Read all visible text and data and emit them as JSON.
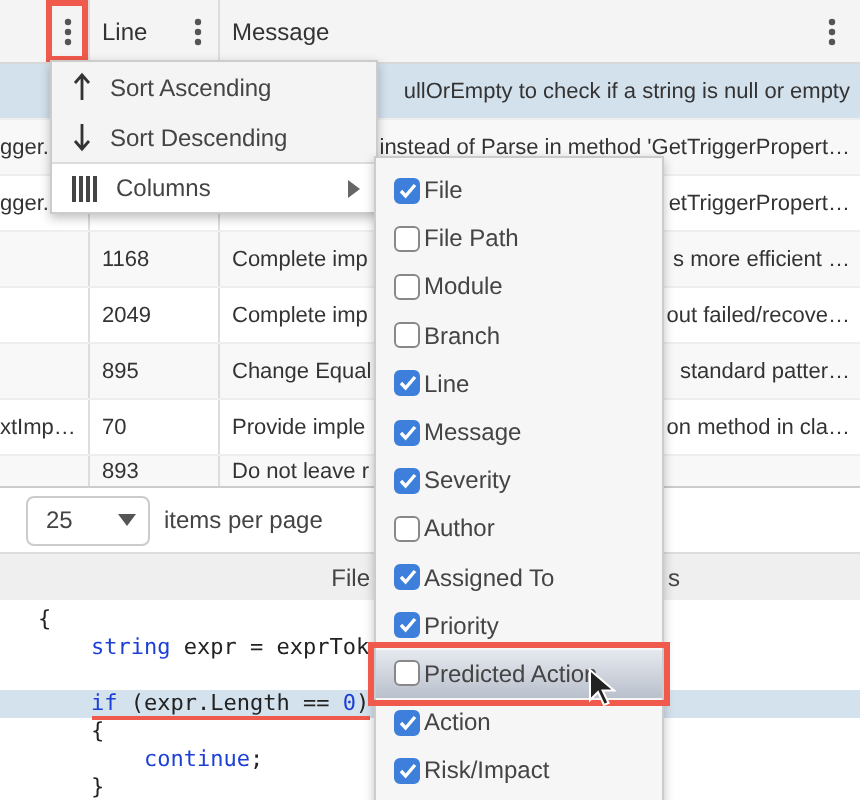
{
  "grid": {
    "columns": [
      {
        "kind": "file",
        "menu_annotated": true
      },
      {
        "kind": "line",
        "label": "Line",
        "menu_annotated": false
      },
      {
        "kind": "message",
        "label": "Message",
        "menu_annotated": false
      }
    ],
    "rows": [
      {
        "selected": true,
        "message_end": "ullOrEmpty to check if a string is null or empty"
      },
      {
        "selected": false,
        "column_1": "gger.",
        "message_end": "instead of Parse in method 'GetTriggerPropert…"
      },
      {
        "selected": false,
        "column_1": "gger.",
        "message_end": "etTriggerPropert…"
      },
      {
        "selected": false,
        "line": "1168",
        "message_start": "Complete imp",
        "message_end": "s more efficient …"
      },
      {
        "selected": false,
        "line": "2049",
        "message_start": "Complete imp",
        "message_end": "out failed/recove…"
      },
      {
        "selected": false,
        "line": "895",
        "message_start": "Change Equal",
        "message_end": "standard patter…"
      },
      {
        "selected": false,
        "column_1": "xtImp…",
        "line": "70",
        "message_start": "Provide imple",
        "message_end": "on method in cla…"
      },
      {
        "selected": false,
        "line": "893",
        "message_start": "Do not leave r"
      }
    ]
  },
  "column_menu": {
    "items": [
      {
        "kind": "sort_ascending",
        "label": "Sort Ascending",
        "expanded": false
      },
      {
        "kind": "sort_descending",
        "label": "Sort Descending",
        "expanded": false
      },
      {
        "kind": "columns",
        "label": "Columns",
        "expanded": true
      }
    ]
  },
  "columns_submenu": {
    "items": [
      {
        "label": "File",
        "checked": true,
        "hovered": false,
        "annotated": false
      },
      {
        "label": "File Path",
        "checked": false,
        "hovered": false,
        "annotated": false
      },
      {
        "label": "Module",
        "checked": false,
        "hovered": false,
        "annotated": false
      },
      {
        "label": "Branch",
        "checked": false,
        "hovered": false,
        "annotated": false
      },
      {
        "label": "Line",
        "checked": true,
        "hovered": false,
        "annotated": false
      },
      {
        "label": "Message",
        "checked": true,
        "hovered": false,
        "annotated": false
      },
      {
        "label": "Severity",
        "checked": true,
        "hovered": false,
        "annotated": false
      },
      {
        "label": "Author",
        "checked": false,
        "hovered": false,
        "annotated": false
      },
      {
        "label": "Assigned To",
        "checked": true,
        "hovered": false,
        "annotated": false
      },
      {
        "label": "Priority",
        "checked": true,
        "hovered": false,
        "annotated": false
      },
      {
        "label": "Predicted Action",
        "checked": false,
        "hovered": true,
        "annotated": true
      },
      {
        "label": "Action",
        "checked": true,
        "hovered": false,
        "annotated": false
      },
      {
        "label": "Risk/Impact",
        "checked": true,
        "hovered": false,
        "annotated": false
      }
    ]
  },
  "pager": {
    "page_size": "25",
    "label": "items per page"
  },
  "file_panel": {
    "title_start": "File",
    "title_end": "s"
  },
  "code": {
    "lines": [
      {
        "selected": false,
        "underlined": false,
        "tokens": [
          {
            "kind": "plain",
            "text": "{"
          }
        ],
        "children": [
          {
            "selected": false,
            "underlined": false,
            "tokens": [
              {
                "kind": "keyword",
                "text": "string"
              },
              {
                "kind": "plain",
                "text": " expr = exprTok"
              }
            ]
          },
          {
            "selected": false,
            "underlined": false
          },
          {
            "selected": true,
            "underlined": true,
            "tokens": [
              {
                "kind": "keyword",
                "text": "if"
              },
              {
                "kind": "plain",
                "text": " (expr.Length == "
              },
              {
                "kind": "number",
                "text": "0"
              },
              {
                "kind": "plain",
                "text": ")"
              }
            ]
          },
          {
            "selected": false,
            "underlined": false,
            "tokens": [
              {
                "kind": "plain",
                "text": "{"
              }
            ],
            "children": [
              {
                "selected": false,
                "underlined": false,
                "tokens": [
                  {
                    "kind": "keyword",
                    "text": "continue"
                  },
                  {
                    "kind": "plain",
                    "text": ";"
                  }
                ]
              }
            ]
          },
          {
            "selected": false,
            "underlined": false,
            "tokens": [
              {
                "kind": "plain",
                "text": "}"
              }
            ]
          }
        ]
      }
    ]
  }
}
